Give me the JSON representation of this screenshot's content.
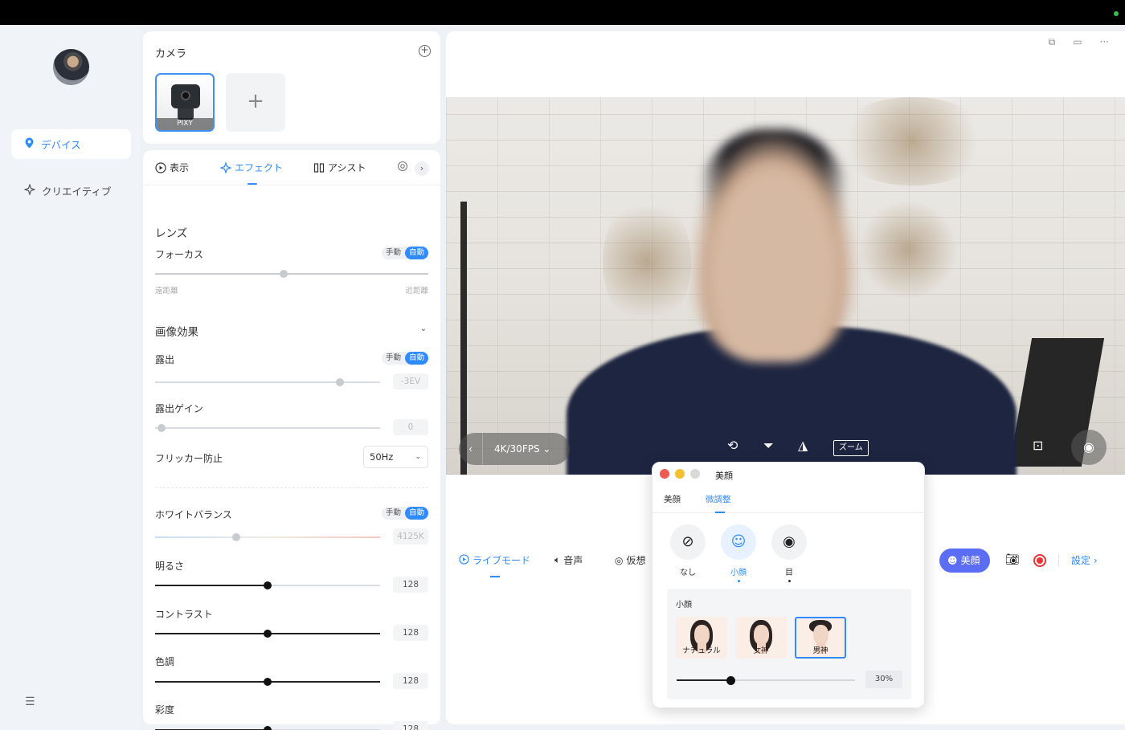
{
  "nav": {
    "items": [
      {
        "label": "デバイス",
        "icon": "pin-icon",
        "active": true
      },
      {
        "label": "クリエイティブ",
        "icon": "sparkle-icon",
        "active": false
      }
    ]
  },
  "camera": {
    "title": "カメラ",
    "devices": [
      {
        "name": "PIXY",
        "selected": true
      }
    ],
    "add_label": "+"
  },
  "settings": {
    "tabs": [
      {
        "label": "表示",
        "active": false
      },
      {
        "label": "エフェクト",
        "active": true
      },
      {
        "label": "アシスト",
        "active": false
      }
    ],
    "lens": {
      "title": "レンズ",
      "focus": {
        "label": "フォーカス",
        "manual": "手動",
        "auto": "自動",
        "value_fraction": 0.47,
        "min_label": "遠距離",
        "max_label": "近距離"
      }
    },
    "image_effects": {
      "title": "画像効果",
      "exposure": {
        "label": "露出",
        "manual": "手動",
        "auto": "自動",
        "value": "-3EV",
        "value_fraction": 0.82
      },
      "exposure_gain": {
        "label": "露出ゲイン",
        "value": "0",
        "value_fraction": 0.03
      },
      "flicker": {
        "label": "フリッカー防止",
        "selected": "50Hz"
      },
      "white_balance": {
        "label": "ホワイトバランス",
        "manual": "手動",
        "auto": "自動",
        "value": "4125K",
        "value_fraction": 0.36
      },
      "brightness": {
        "label": "明るさ",
        "value": "128",
        "value_fraction": 0.5
      },
      "contrast": {
        "label": "コントラスト",
        "value": "128",
        "value_fraction": 0.5
      },
      "hue": {
        "label": "色調",
        "value": "128",
        "value_fraction": 0.5
      },
      "saturation": {
        "label": "彩度",
        "value": "128",
        "value_fraction": 0.5
      }
    }
  },
  "preview": {
    "resolution": "4K/30FPS",
    "zoom_label": "ズーム"
  },
  "bottom_bar": {
    "tabs": [
      {
        "label": "ライブモード",
        "active": true
      },
      {
        "label": "音声",
        "active": false
      },
      {
        "label": "仮想",
        "active": false
      }
    ],
    "beauty_button": "美顔",
    "settings_link": "設定"
  },
  "beauty_popup": {
    "title": "美顔",
    "tabs": [
      {
        "label": "美顔",
        "active": false
      },
      {
        "label": "微調整",
        "active": true
      }
    ],
    "options": [
      {
        "label": "なし",
        "icon": "none-icon",
        "active": false
      },
      {
        "label": "小顔",
        "icon": "face-icon",
        "active": true
      },
      {
        "label": "目",
        "icon": "eye-icon",
        "active": false
      }
    ],
    "sub_title": "小顔",
    "presets": [
      {
        "label": "ナチュラル",
        "selected": false
      },
      {
        "label": "女神",
        "selected": false
      },
      {
        "label": "男神",
        "selected": true
      }
    ],
    "strength": "30%",
    "strength_fraction": 0.3
  },
  "colors": {
    "accent": "#2f8bff",
    "beauty_button": "#5b6cf5",
    "record": "#ee3333"
  }
}
